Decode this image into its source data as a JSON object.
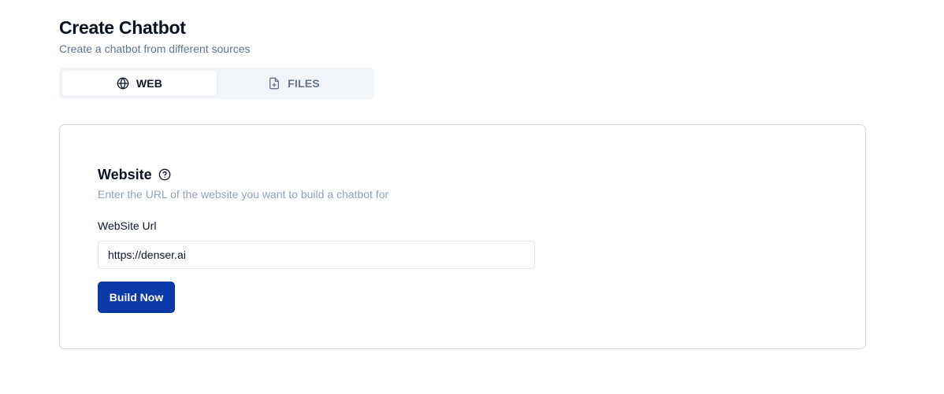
{
  "header": {
    "title": "Create Chatbot",
    "subtitle": "Create a chatbot from different sources"
  },
  "tabs": [
    {
      "label": "WEB",
      "icon": "globe-icon",
      "active": true
    },
    {
      "label": "FILES",
      "icon": "file-plus-icon",
      "active": false
    }
  ],
  "website_section": {
    "title": "Website",
    "help_icon": "help-circle-icon",
    "description": "Enter the URL of the website you want to build a chatbot for",
    "url_label": "WebSite Url",
    "url_value": "https://denser.ai",
    "build_button_label": "Build Now"
  },
  "colors": {
    "primary_button": "#0b3aa8",
    "tab_bar_bg": "#f1f5f9",
    "muted_text": "#94a3b8"
  }
}
